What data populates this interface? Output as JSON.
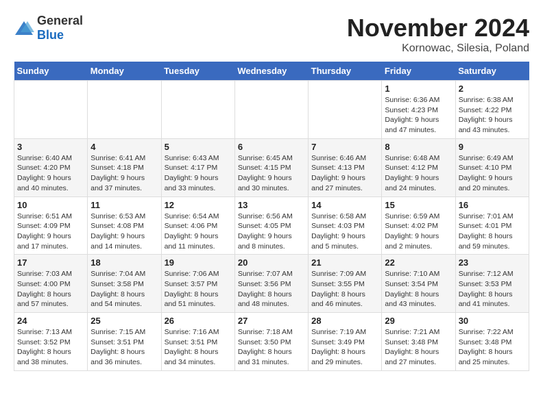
{
  "header": {
    "logo_general": "General",
    "logo_blue": "Blue",
    "month": "November 2024",
    "location": "Kornowac, Silesia, Poland"
  },
  "days_of_week": [
    "Sunday",
    "Monday",
    "Tuesday",
    "Wednesday",
    "Thursday",
    "Friday",
    "Saturday"
  ],
  "weeks": [
    [
      {
        "day": "",
        "info": ""
      },
      {
        "day": "",
        "info": ""
      },
      {
        "day": "",
        "info": ""
      },
      {
        "day": "",
        "info": ""
      },
      {
        "day": "",
        "info": ""
      },
      {
        "day": "1",
        "info": "Sunrise: 6:36 AM\nSunset: 4:23 PM\nDaylight: 9 hours and 47 minutes."
      },
      {
        "day": "2",
        "info": "Sunrise: 6:38 AM\nSunset: 4:22 PM\nDaylight: 9 hours and 43 minutes."
      }
    ],
    [
      {
        "day": "3",
        "info": "Sunrise: 6:40 AM\nSunset: 4:20 PM\nDaylight: 9 hours and 40 minutes."
      },
      {
        "day": "4",
        "info": "Sunrise: 6:41 AM\nSunset: 4:18 PM\nDaylight: 9 hours and 37 minutes."
      },
      {
        "day": "5",
        "info": "Sunrise: 6:43 AM\nSunset: 4:17 PM\nDaylight: 9 hours and 33 minutes."
      },
      {
        "day": "6",
        "info": "Sunrise: 6:45 AM\nSunset: 4:15 PM\nDaylight: 9 hours and 30 minutes."
      },
      {
        "day": "7",
        "info": "Sunrise: 6:46 AM\nSunset: 4:13 PM\nDaylight: 9 hours and 27 minutes."
      },
      {
        "day": "8",
        "info": "Sunrise: 6:48 AM\nSunset: 4:12 PM\nDaylight: 9 hours and 24 minutes."
      },
      {
        "day": "9",
        "info": "Sunrise: 6:49 AM\nSunset: 4:10 PM\nDaylight: 9 hours and 20 minutes."
      }
    ],
    [
      {
        "day": "10",
        "info": "Sunrise: 6:51 AM\nSunset: 4:09 PM\nDaylight: 9 hours and 17 minutes."
      },
      {
        "day": "11",
        "info": "Sunrise: 6:53 AM\nSunset: 4:08 PM\nDaylight: 9 hours and 14 minutes."
      },
      {
        "day": "12",
        "info": "Sunrise: 6:54 AM\nSunset: 4:06 PM\nDaylight: 9 hours and 11 minutes."
      },
      {
        "day": "13",
        "info": "Sunrise: 6:56 AM\nSunset: 4:05 PM\nDaylight: 9 hours and 8 minutes."
      },
      {
        "day": "14",
        "info": "Sunrise: 6:58 AM\nSunset: 4:03 PM\nDaylight: 9 hours and 5 minutes."
      },
      {
        "day": "15",
        "info": "Sunrise: 6:59 AM\nSunset: 4:02 PM\nDaylight: 9 hours and 2 minutes."
      },
      {
        "day": "16",
        "info": "Sunrise: 7:01 AM\nSunset: 4:01 PM\nDaylight: 8 hours and 59 minutes."
      }
    ],
    [
      {
        "day": "17",
        "info": "Sunrise: 7:03 AM\nSunset: 4:00 PM\nDaylight: 8 hours and 57 minutes."
      },
      {
        "day": "18",
        "info": "Sunrise: 7:04 AM\nSunset: 3:58 PM\nDaylight: 8 hours and 54 minutes."
      },
      {
        "day": "19",
        "info": "Sunrise: 7:06 AM\nSunset: 3:57 PM\nDaylight: 8 hours and 51 minutes."
      },
      {
        "day": "20",
        "info": "Sunrise: 7:07 AM\nSunset: 3:56 PM\nDaylight: 8 hours and 48 minutes."
      },
      {
        "day": "21",
        "info": "Sunrise: 7:09 AM\nSunset: 3:55 PM\nDaylight: 8 hours and 46 minutes."
      },
      {
        "day": "22",
        "info": "Sunrise: 7:10 AM\nSunset: 3:54 PM\nDaylight: 8 hours and 43 minutes."
      },
      {
        "day": "23",
        "info": "Sunrise: 7:12 AM\nSunset: 3:53 PM\nDaylight: 8 hours and 41 minutes."
      }
    ],
    [
      {
        "day": "24",
        "info": "Sunrise: 7:13 AM\nSunset: 3:52 PM\nDaylight: 8 hours and 38 minutes."
      },
      {
        "day": "25",
        "info": "Sunrise: 7:15 AM\nSunset: 3:51 PM\nDaylight: 8 hours and 36 minutes."
      },
      {
        "day": "26",
        "info": "Sunrise: 7:16 AM\nSunset: 3:51 PM\nDaylight: 8 hours and 34 minutes."
      },
      {
        "day": "27",
        "info": "Sunrise: 7:18 AM\nSunset: 3:50 PM\nDaylight: 8 hours and 31 minutes."
      },
      {
        "day": "28",
        "info": "Sunrise: 7:19 AM\nSunset: 3:49 PM\nDaylight: 8 hours and 29 minutes."
      },
      {
        "day": "29",
        "info": "Sunrise: 7:21 AM\nSunset: 3:48 PM\nDaylight: 8 hours and 27 minutes."
      },
      {
        "day": "30",
        "info": "Sunrise: 7:22 AM\nSunset: 3:48 PM\nDaylight: 8 hours and 25 minutes."
      }
    ]
  ]
}
